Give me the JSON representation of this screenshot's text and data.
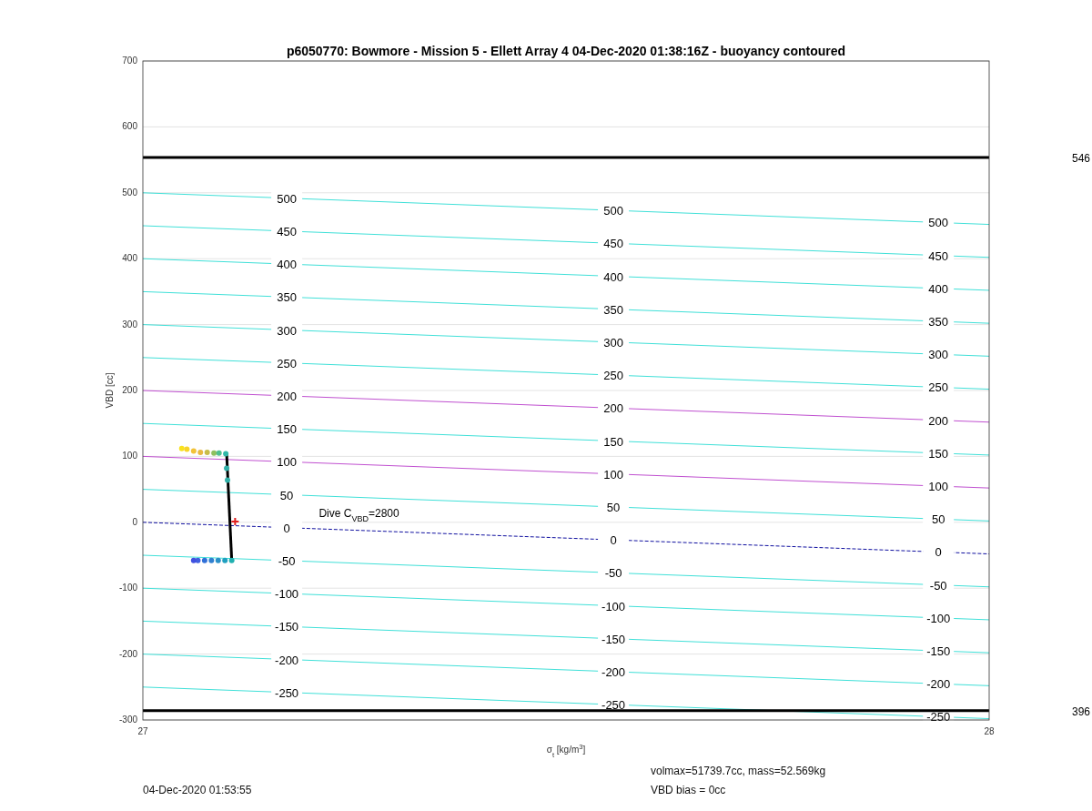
{
  "chart": {
    "chart_data": {
      "type": "line",
      "title": "p6050770: Bowmore - Mission 5 - Ellett Array 4 04-Dec-2020 01:38:16Z - buoyancy contoured",
      "xlabel": "σ$_{t}$ [kg/m$^{3}$]",
      "ylabel": "VBD [cc]",
      "x": [
        27,
        28
      ],
      "xlim": [
        27,
        28
      ],
      "ylim": [
        -300,
        700
      ],
      "xticks": [
        27,
        28
      ],
      "yticks": [
        -300,
        -200,
        -100,
        0,
        100,
        200,
        300,
        400,
        500,
        600,
        700
      ],
      "grid": true,
      "series": [
        {
          "name": "500",
          "color": "#40e0d8",
          "line_style": "solid",
          "values": [
            500,
            452
          ]
        },
        {
          "name": "450",
          "color": "#40e0d8",
          "line_style": "solid",
          "values": [
            450,
            402
          ]
        },
        {
          "name": "400",
          "color": "#40e0d8",
          "line_style": "solid",
          "values": [
            400,
            352
          ]
        },
        {
          "name": "350",
          "color": "#40e0d8",
          "line_style": "solid",
          "values": [
            350,
            302
          ]
        },
        {
          "name": "300",
          "color": "#40e0d8",
          "line_style": "solid",
          "values": [
            300,
            252
          ]
        },
        {
          "name": "250",
          "color": "#40e0d8",
          "line_style": "solid",
          "values": [
            250,
            202
          ]
        },
        {
          "name": "200",
          "color": "#c050d0",
          "line_style": "solid",
          "values": [
            200,
            152
          ]
        },
        {
          "name": "150",
          "color": "#40e0d8",
          "line_style": "solid",
          "values": [
            150,
            102
          ]
        },
        {
          "name": "100",
          "color": "#c050d0",
          "line_style": "solid",
          "values": [
            100,
            52
          ]
        },
        {
          "name": "50",
          "color": "#40e0d8",
          "line_style": "solid",
          "values": [
            50,
            2
          ]
        },
        {
          "name": "0",
          "color": "#1010a0",
          "line_style": "dashed",
          "values": [
            0,
            -48
          ]
        },
        {
          "name": "-50",
          "color": "#40e0d8",
          "line_style": "solid",
          "values": [
            -50,
            -98
          ]
        },
        {
          "name": "-100",
          "color": "#40e0d8",
          "line_style": "solid",
          "values": [
            -100,
            -148
          ]
        },
        {
          "name": "-150",
          "color": "#40e0d8",
          "line_style": "solid",
          "values": [
            -150,
            -198
          ]
        },
        {
          "name": "-200",
          "color": "#40e0d8",
          "line_style": "solid",
          "values": [
            -200,
            -248
          ]
        },
        {
          "name": "-250",
          "color": "#40e0d8",
          "line_style": "solid",
          "values": [
            -250,
            -298
          ]
        }
      ],
      "ref_lines": [
        {
          "axis": "y",
          "value": 553.6,
          "color": "#000000"
        },
        {
          "axis": "y",
          "value": -286,
          "color": "#000000"
        }
      ],
      "annotations": [
        "Dive C$_{VBD}$=2800"
      ]
    },
    "side_labels": [
      "546",
      "396"
    ]
  },
  "footer": {
    "timestamp": "04-Dec-2020 01:53:55",
    "lines": [
      "volmax=51739.7cc, mass=52.569kg",
      "VBD bias = 0cc"
    ]
  }
}
